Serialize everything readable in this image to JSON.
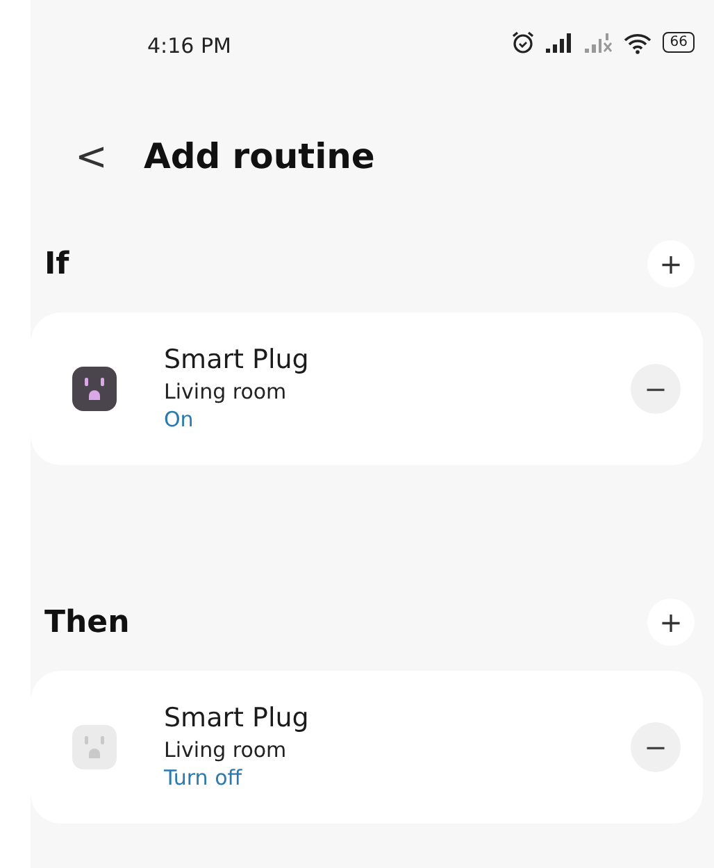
{
  "status_bar": {
    "time": "4:16 PM",
    "battery": "66"
  },
  "header": {
    "back": "<",
    "title": "Add routine"
  },
  "sections": [
    {
      "title": "If",
      "add": "+",
      "items": [
        {
          "name": "Smart Plug",
          "room": "Living room",
          "action": "On",
          "powered": true,
          "remove": "−"
        }
      ]
    },
    {
      "title": "Then",
      "add": "+",
      "items": [
        {
          "name": "Smart Plug",
          "room": "Living room",
          "action": "Turn off",
          "powered": false,
          "remove": "−"
        }
      ]
    }
  ]
}
